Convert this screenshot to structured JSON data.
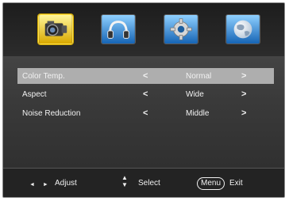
{
  "tabs": [
    {
      "name": "picture",
      "icon": "camera-icon",
      "selected": true
    },
    {
      "name": "sound",
      "icon": "headphones-icon",
      "selected": false
    },
    {
      "name": "settings",
      "icon": "gear-icon",
      "selected": false
    },
    {
      "name": "network",
      "icon": "globe-icon",
      "selected": false
    }
  ],
  "menu": {
    "rows": [
      {
        "label": "Color Temp.",
        "left": "<",
        "value": "Normal",
        "right": ">",
        "selected": true
      },
      {
        "label": "Aspect",
        "left": "<",
        "value": "Wide",
        "right": ">",
        "selected": false
      },
      {
        "label": "Noise Reduction",
        "left": "<",
        "value": "Middle",
        "right": ">",
        "selected": false
      }
    ]
  },
  "footer": {
    "adjust_icon": "◄ ►",
    "adjust_label": "Adjust",
    "select_icon": "▲\n▼",
    "select_label": "Select",
    "menu_key": "Menu",
    "exit_label": "Exit"
  },
  "colors": {
    "selected_row": "#aeaeae",
    "tab_selected_border": "#ffe04a"
  }
}
